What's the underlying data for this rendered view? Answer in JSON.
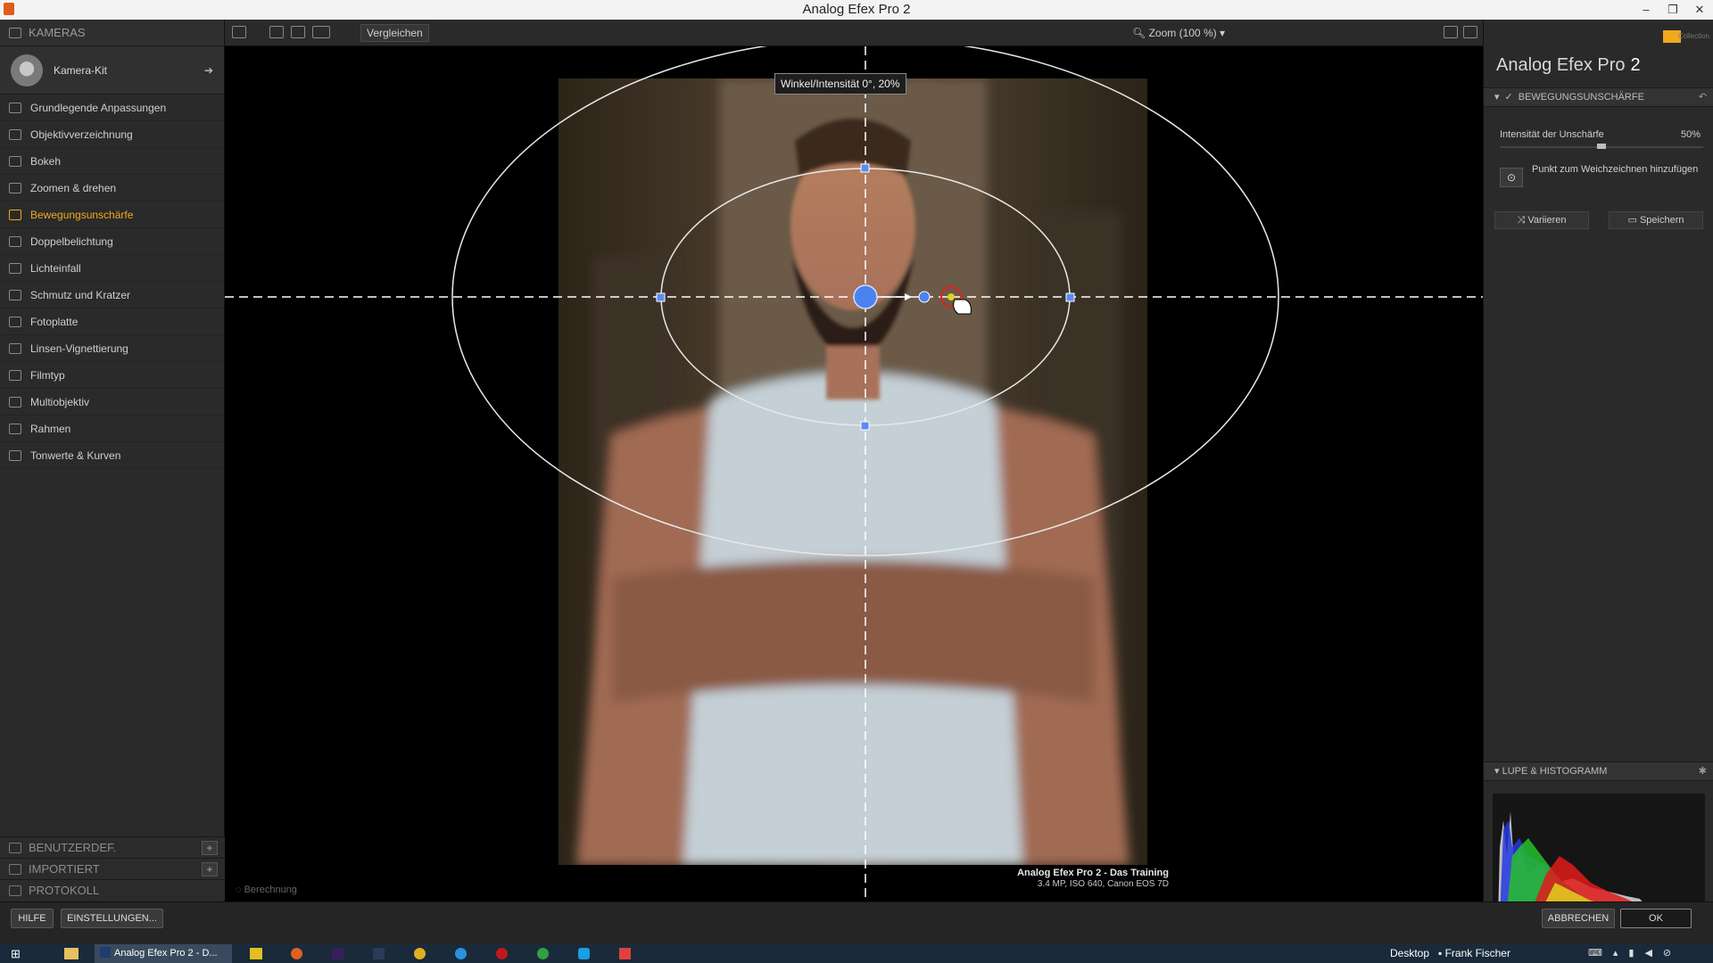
{
  "window": {
    "title": "Analog Efex Pro 2",
    "controls": [
      "–",
      "❐",
      "✕"
    ]
  },
  "left": {
    "header": "KAMERAS",
    "camera_kit": "Kamera-Kit",
    "menu": [
      "Grundlegende Anpassungen",
      "Objektivverzeichnung",
      "Bokeh",
      "Zoomen & drehen",
      "Bewegungsunschärfe",
      "Doppelbelichtung",
      "Lichteinfall",
      "Schmutz und Kratzer",
      "Fotoplatte",
      "Linsen-Vignettierung",
      "Filmtyp",
      "Multiobjektiv",
      "Rahmen",
      "Tonwerte & Kurven"
    ],
    "active_index": 4,
    "bottom": {
      "user_defined": "BENUTZERDEF.",
      "imported": "IMPORTIERT",
      "history": "PROTOKOLL"
    }
  },
  "toolbar": {
    "compare": "Vergleichen",
    "zoom": "Zoom (100 %)"
  },
  "canvas": {
    "tooltip": "Winkel/Intensität  0°, 20%",
    "caption_title": "Analog Efex Pro 2 - Das Training",
    "caption_sub": "3.4 MP, ISO 640, Canon EOS 7D",
    "status": "Berechnung"
  },
  "right": {
    "brand": "Analog Efex Pro",
    "brand_version": "2",
    "section": "BEWEGUNGSUNSCHÄRFE",
    "slider": {
      "label": "Intensität der Unschärfe",
      "value": "50%",
      "fraction": 0.5
    },
    "add_point": "Punkt zum Weichzeichnen hinzufügen",
    "vary": "Variieren",
    "save": "Speichern",
    "histogram_section": "LUPE & HISTOGRAMM"
  },
  "bottom": {
    "help": "HILFE",
    "settings": "EINSTELLUNGEN...",
    "cancel": "ABBRECHEN",
    "ok": "OK"
  },
  "taskbar": {
    "active_app": "Analog Efex Pro 2 - D...",
    "desktop": "Desktop",
    "user": "Frank Fischer"
  },
  "colors": {
    "accent": "#f2a81d",
    "handle": "#4a82f0"
  }
}
